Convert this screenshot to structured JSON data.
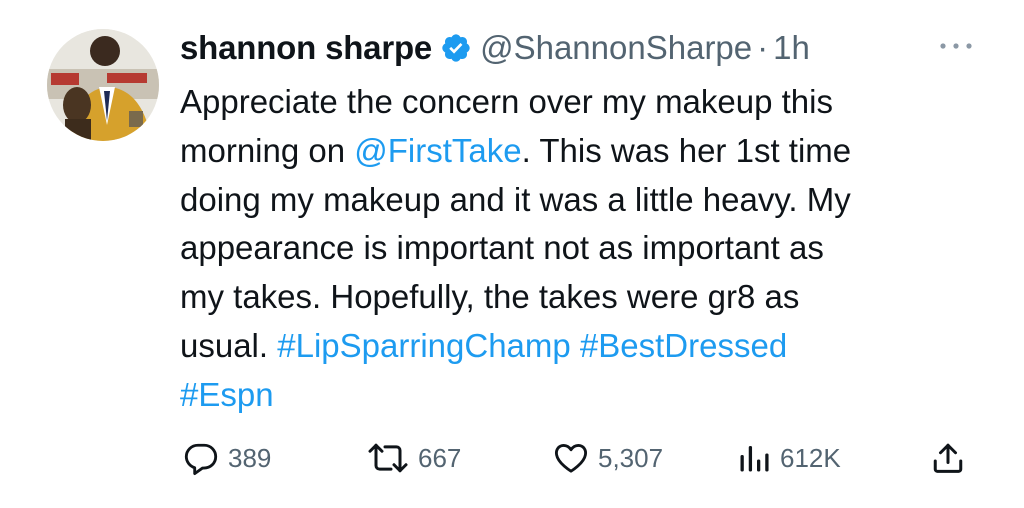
{
  "tweet": {
    "display_name": "shannon sharpe",
    "handle": "@ShannonSharpe",
    "separator": "·",
    "time": "1h",
    "lines": [
      [
        "Appreciate the concern over my makeup this"
      ],
      [
        "morning on ",
        "@FirstTake",
        ". This was her 1st time"
      ],
      [
        "doing my makeup and it was a little heavy. My"
      ],
      [
        "appearance is important not as important as"
      ],
      [
        "my takes. Hopefully, the takes were gr8 as"
      ],
      [
        "usual. ",
        "#LipSparringChamp",
        " ",
        "#BestDressed"
      ],
      [
        "#Espn"
      ]
    ]
  },
  "actions": {
    "replies": "389",
    "retweets": "667",
    "likes": "5,307",
    "views": "612K"
  },
  "icons": {
    "verified": "verified-badge-icon",
    "more": "more-options-icon",
    "reply": "reply-icon",
    "retweet": "retweet-icon",
    "like": "heart-icon",
    "views": "views-icon",
    "share": "share-icon"
  },
  "colors": {
    "text": "#0f1419",
    "secondary": "#536471",
    "link": "#1d9bf0",
    "background": "#ffffff"
  }
}
